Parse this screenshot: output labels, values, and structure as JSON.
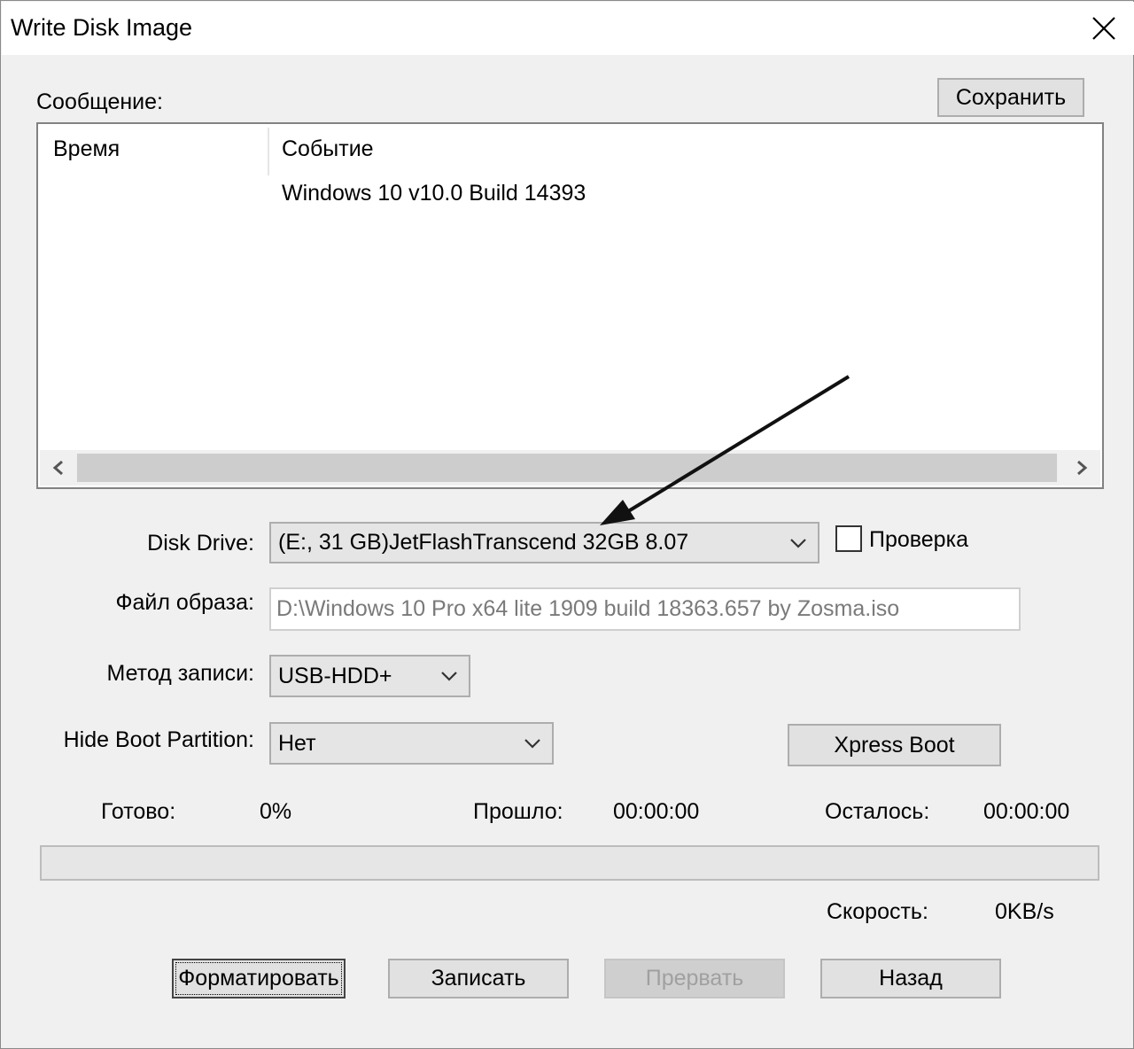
{
  "window": {
    "title": "Write Disk Image"
  },
  "message": {
    "label": "Сообщение:",
    "save_label": "Сохранить",
    "columns": [
      "Время",
      "Событие"
    ],
    "rows": [
      {
        "time": "",
        "event": "Windows 10 v10.0 Build 14393"
      }
    ]
  },
  "form": {
    "disk_drive_label": "Disk Drive:",
    "disk_drive_value": "(E:, 31 GB)JetFlashTranscend 32GB  8.07",
    "verify_label": "Проверка",
    "verify_checked": false,
    "image_file_label": "Файл образа:",
    "image_file_value": "D:\\Windows 10 Pro x64 lite 1909 build 18363.657 by Zosma.iso",
    "write_method_label": "Метод записи:",
    "write_method_value": "USB-HDD+",
    "hide_boot_label": "Hide Boot Partition:",
    "hide_boot_value": "Нет",
    "xpress_boot_label": "Xpress Boot"
  },
  "status": {
    "done_label": "Готово:",
    "done_value": "0%",
    "elapsed_label": "Прошло:",
    "elapsed_value": "00:00:00",
    "remaining_label": "Осталось:",
    "remaining_value": "00:00:00",
    "speed_label": "Скорость:",
    "speed_value": "0KB/s",
    "progress_fraction": 0
  },
  "buttons": {
    "format": "Форматировать",
    "write": "Записать",
    "abort": "Прервать",
    "back": "Назад"
  },
  "colors": {
    "dialog_bg": "#f0f0f0",
    "button_bg": "#e1e1e1",
    "disabled_text": "#a0a0a0",
    "annotation_arrow": "#111111"
  }
}
